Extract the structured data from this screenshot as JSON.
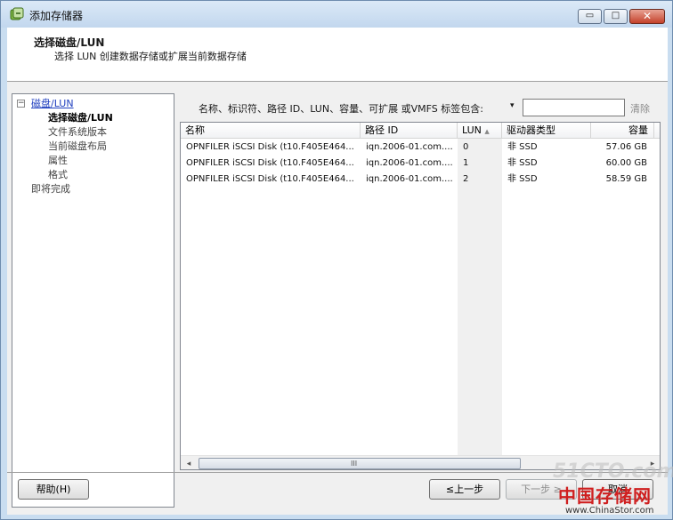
{
  "window": {
    "title": "添加存储器",
    "minimize_glyph": "▭",
    "maximize_glyph": "□",
    "close_glyph": "✕"
  },
  "header": {
    "title": "选择磁盘/LUN",
    "subtitle": "选择 LUN 创建数据存储或扩展当前数据存储"
  },
  "nav": {
    "toggle": "−",
    "items": [
      {
        "label": "磁盘/LUN",
        "state": "link"
      },
      {
        "label": "选择磁盘/LUN",
        "state": "active"
      },
      {
        "label": "文件系统版本",
        "state": "inactive"
      },
      {
        "label": "当前磁盘布局",
        "state": "inactive"
      },
      {
        "label": "属性",
        "state": "inactive"
      },
      {
        "label": "格式",
        "state": "inactive"
      },
      {
        "label": "即将完成",
        "state": "inactive"
      }
    ]
  },
  "filter": {
    "label": "名称、标识符、路径 ID、LUN、容量、可扩展 或VMFS 标签包含:",
    "dropdown_glyph": "▾",
    "value": "",
    "clear_label": "清除"
  },
  "table": {
    "columns": [
      "名称",
      "路径 ID",
      "LUN",
      "驱动器类型",
      "容量"
    ],
    "sort_indicator": "▲",
    "rows": [
      [
        "OPNFILER iSCSI Disk (t10.F405E464...",
        "iqn.2006-01.com....",
        "0",
        "非 SSD",
        "57.06 GB"
      ],
      [
        "OPNFILER iSCSI Disk (t10.F405E464...",
        "iqn.2006-01.com....",
        "1",
        "非 SSD",
        "60.00 GB"
      ],
      [
        "OPNFILER iSCSI Disk (t10.F405E464...",
        "iqn.2006-01.com....",
        "2",
        "非 SSD",
        "58.59 GB"
      ]
    ],
    "scroll_left": "◂",
    "scroll_right": "▸",
    "scroll_grip": "III"
  },
  "footer": {
    "help_label": "帮助(H)",
    "back_label": "≤上一步",
    "next_label": "下一步 ≥",
    "cancel_label": "取消"
  },
  "watermark": {
    "site": "51CTO.com",
    "brand": "中国存储网",
    "url": "www.ChinaStor.com"
  }
}
